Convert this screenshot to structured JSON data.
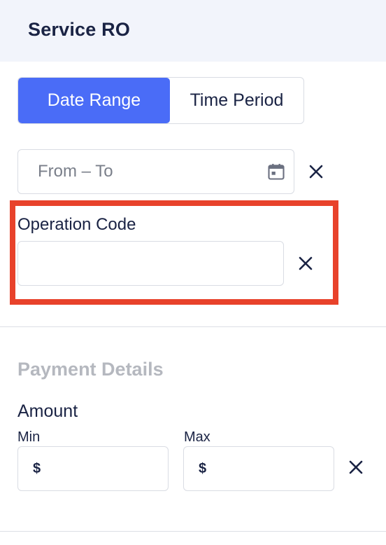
{
  "header": {
    "title": "Service RO"
  },
  "toggle": {
    "options": [
      {
        "label": "Date Range",
        "active": true
      },
      {
        "label": "Time Period",
        "active": false
      }
    ],
    "active_color": "#4a6cf7"
  },
  "date_range": {
    "placeholder": "From – To",
    "icon": "calendar-icon",
    "clear_icon": "close-icon"
  },
  "operation_code": {
    "label": "Operation Code",
    "value": "",
    "clear_icon": "close-icon",
    "highlight_color": "#e8422b"
  },
  "payment_details": {
    "title": "Payment Details",
    "amount": {
      "label": "Amount",
      "min": {
        "label": "Min",
        "currency": "$",
        "value": ""
      },
      "max": {
        "label": "Max",
        "currency": "$",
        "value": ""
      },
      "clear_icon": "close-icon"
    }
  }
}
